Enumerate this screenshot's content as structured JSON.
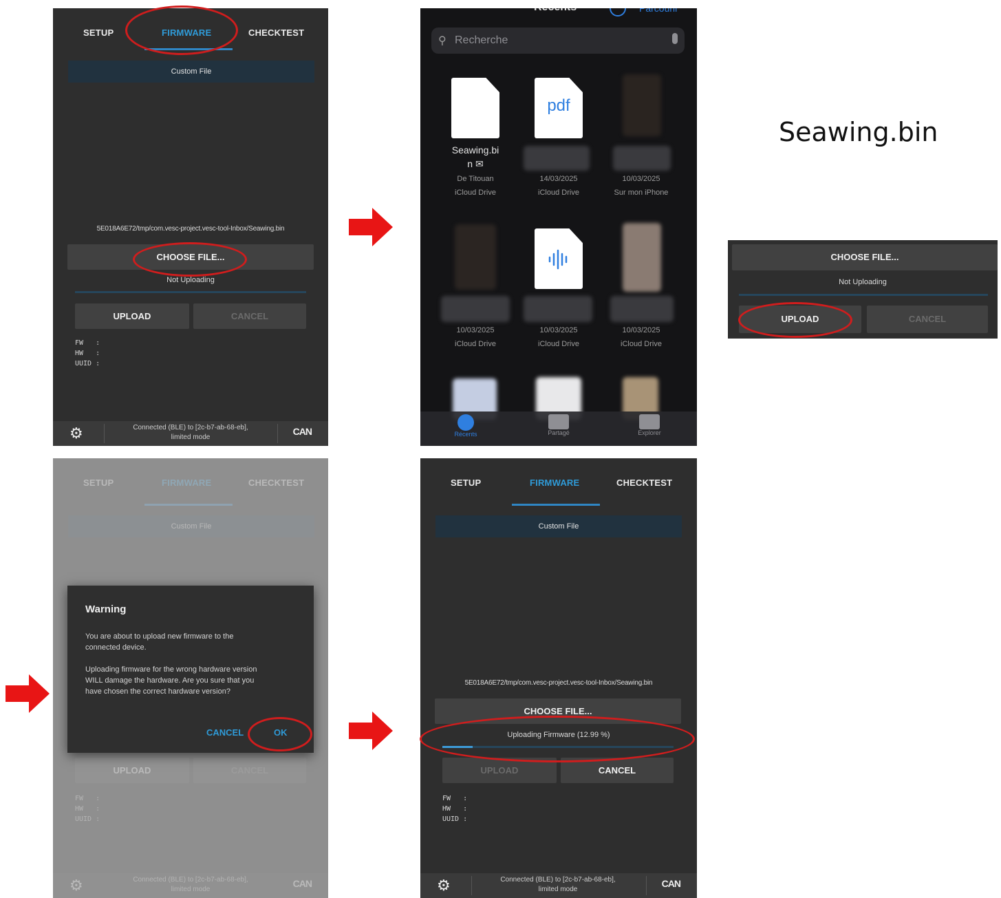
{
  "tabs": {
    "setup": "SETUP",
    "firmware": "FIRMWARE",
    "checktest": "CHECKTEST"
  },
  "custom_file": "Custom File",
  "file_path": "5E018A6E72/tmp/com.vesc-project.vesc-tool-Inbox/Seawing.bin",
  "buttons": {
    "choose_file": "CHOOSE FILE...",
    "upload": "UPLOAD",
    "cancel": "CANCEL",
    "ok": "OK"
  },
  "status": {
    "not_uploading": "Not Uploading",
    "uploading": "Uploading Firmware (12.99 %)",
    "progress": 0.1299
  },
  "info": {
    "fw": "FW   :",
    "hw": "HW   :",
    "uuid": "UUID :"
  },
  "footer": {
    "line1": "Connected (BLE) to [2c-b7-ab-68-eb],",
    "line2": "limited mode",
    "can": "CAN"
  },
  "picker": {
    "header": "Récents",
    "right_link": "Parcourir",
    "search_placeholder": "Recherche",
    "items": [
      {
        "name": "Seawing.bi",
        "name2": "n ✉",
        "date": "De Titouan",
        "loc": "iCloud Drive"
      },
      {
        "icon": "pdf",
        "date": "14/03/2025",
        "loc": "iCloud Drive"
      },
      {
        "date": "10/03/2025",
        "loc": "Sur mon iPhone"
      },
      {
        "date": "10/03/2025",
        "loc": "iCloud Drive"
      },
      {
        "date": "10/03/2025",
        "loc": "iCloud Drive"
      },
      {
        "date": "10/03/2025",
        "loc": "iCloud Drive"
      }
    ],
    "tabbar": [
      "Récents",
      "Partagé",
      "Explorer"
    ]
  },
  "filename_callout": "Seawing.bin",
  "dialog": {
    "title": "Warning",
    "p1a": "You are about to upload new firmware to the",
    "p1b": "connected device.",
    "p2a": "Uploading firmware for the wrong hardware version",
    "p2b": "WILL damage the hardware. Are you sure that you",
    "p2c": "have chosen the correct hardware version?"
  },
  "colors": {
    "accent": "#2f9bd8",
    "annotation": "#d01d1d",
    "panel": "#2e2e2e"
  }
}
